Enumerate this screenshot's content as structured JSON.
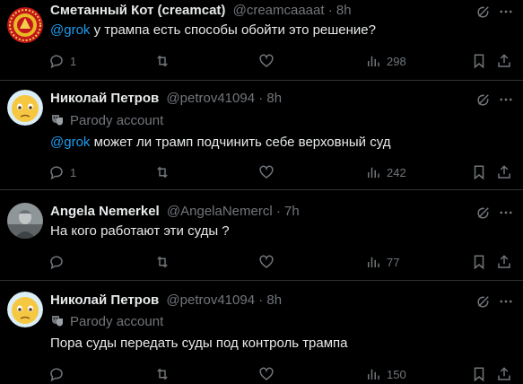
{
  "tweets": [
    {
      "name": "Сметанный Кот (creamcat)",
      "handle": "@creamcaaaat",
      "sep": "·",
      "time": "8h",
      "parody": "",
      "mention": "@grok",
      "text": " у трампа есть способы обойти это решение?",
      "replies": "1",
      "retweets": "",
      "likes": "",
      "views": "298",
      "avatar": "emblem"
    },
    {
      "name": "Николай Петров",
      "handle": "@petrov41094",
      "sep": "·",
      "time": "8h",
      "parody": "Parody account",
      "mention": "@grok",
      "text": " может ли трамп подчинить себе верховный суд",
      "replies": "1",
      "retweets": "",
      "likes": "",
      "views": "242",
      "avatar": "emoji-face"
    },
    {
      "name": "Angela Nemerkel",
      "handle": "@AngelaNemercl",
      "sep": "·",
      "time": "7h",
      "parody": "",
      "mention": "",
      "text": "На кого работают эти суды ?",
      "replies": "",
      "retweets": "",
      "likes": "",
      "views": "77",
      "avatar": "photo-gray"
    },
    {
      "name": "Николай Петров",
      "handle": "@petrov41094",
      "sep": "·",
      "time": "8h",
      "parody": "Parody account",
      "mention": "",
      "text": "Пора суды передать суды под контроль трампа",
      "replies": "",
      "retweets": "",
      "likes": "",
      "views": "150",
      "avatar": "emoji-face"
    }
  ],
  "icons": {
    "reply": "reply-icon",
    "retweet": "retweet-icon",
    "like": "heart-icon",
    "views": "views-icon",
    "bookmark": "bookmark-icon",
    "share": "share-icon",
    "grok": "grok-icon",
    "more": "more-icon",
    "parody": "theater-mask-icon"
  },
  "colors": {
    "background": "#000000",
    "text": "#e7e9ea",
    "muted": "#71767b",
    "link": "#1d9bf0",
    "divider": "#2f3336"
  }
}
